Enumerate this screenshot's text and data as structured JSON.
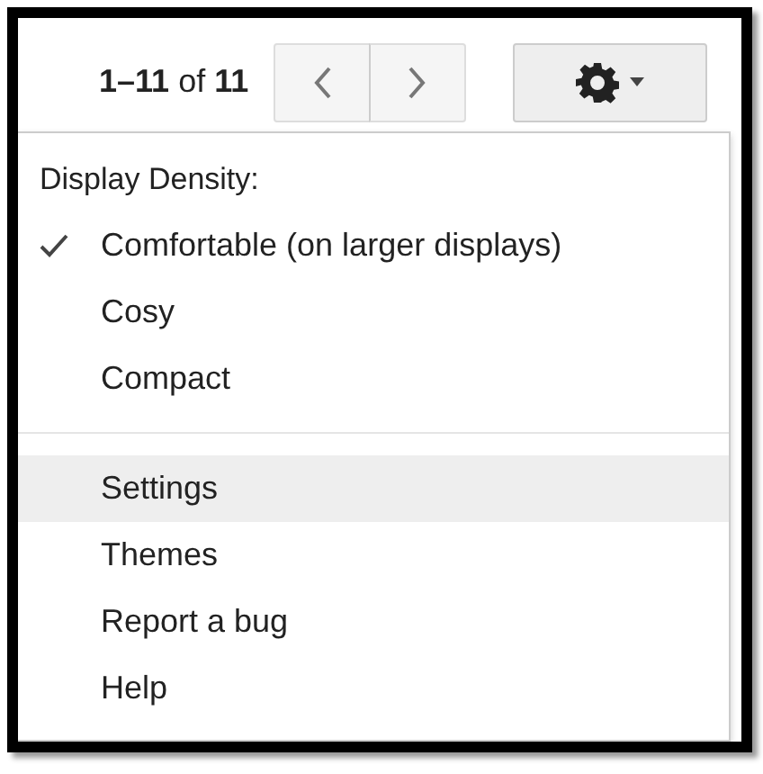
{
  "toolbar": {
    "pager": "**1–11** of **11**"
  },
  "menu": {
    "heading": "Display Density:",
    "sections": [
      {
        "items": [
          {
            "label": "Comfortable (on larger displays)",
            "checked": true,
            "selected": false
          },
          {
            "label": "Cosy",
            "checked": false,
            "selected": false
          },
          {
            "label": "Compact",
            "checked": false,
            "selected": false
          }
        ]
      },
      {
        "items": [
          {
            "label": "Settings",
            "checked": false,
            "selected": true
          },
          {
            "label": "Themes",
            "checked": false,
            "selected": false
          },
          {
            "label": "Report a bug",
            "checked": false,
            "selected": false
          },
          {
            "label": "Help",
            "checked": false,
            "selected": false
          }
        ]
      }
    ]
  }
}
